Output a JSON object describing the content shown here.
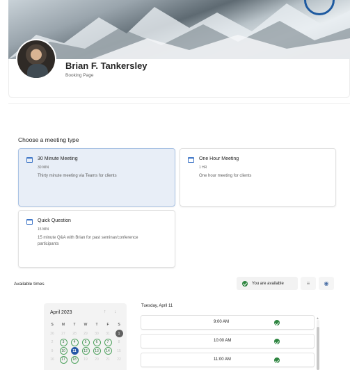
{
  "profile": {
    "name": "Brian F. Tankersley",
    "subtitle": "Booking Page"
  },
  "meeting_section": {
    "title": "Choose a meeting type",
    "types": [
      {
        "title": "30 Minute Meeting",
        "duration": "30 MIN",
        "description": "Thirty minute meeting via Teams for clients",
        "selected": true
      },
      {
        "title": "One Hour Meeting",
        "duration": "1 HR",
        "description": "One hour meeting for clients",
        "selected": false
      },
      {
        "title": "Quick Question",
        "duration": "15 MIN",
        "description": "15 minute Q&A with Brian for past seminar/conference participants",
        "selected": false
      }
    ]
  },
  "availability": {
    "title": "Available times",
    "status": "You are available",
    "filter_icon": "filter-icon",
    "people_icon": "people-icon"
  },
  "calendar": {
    "month": "April 2023",
    "weekdays": [
      "S",
      "M",
      "T",
      "W",
      "T",
      "F",
      "S"
    ],
    "rows": [
      [
        "26",
        "27",
        "28",
        "29",
        "30",
        "31",
        "1"
      ],
      [
        "2",
        "3",
        "4",
        "5",
        "6",
        "7",
        "8"
      ],
      [
        "9",
        "10",
        "11",
        "12",
        "13",
        "14",
        "15"
      ],
      [
        "16",
        "17",
        "18",
        "19",
        "20",
        "21",
        "22"
      ]
    ]
  },
  "slots": {
    "date": "Tuesday, April 11",
    "times": [
      "9:00 AM",
      "10:00 AM",
      "11:00 AM"
    ]
  },
  "colors": {
    "accent": "#2557a7",
    "available": "#2e8540",
    "selected_card_bg": "#e8eef7"
  }
}
